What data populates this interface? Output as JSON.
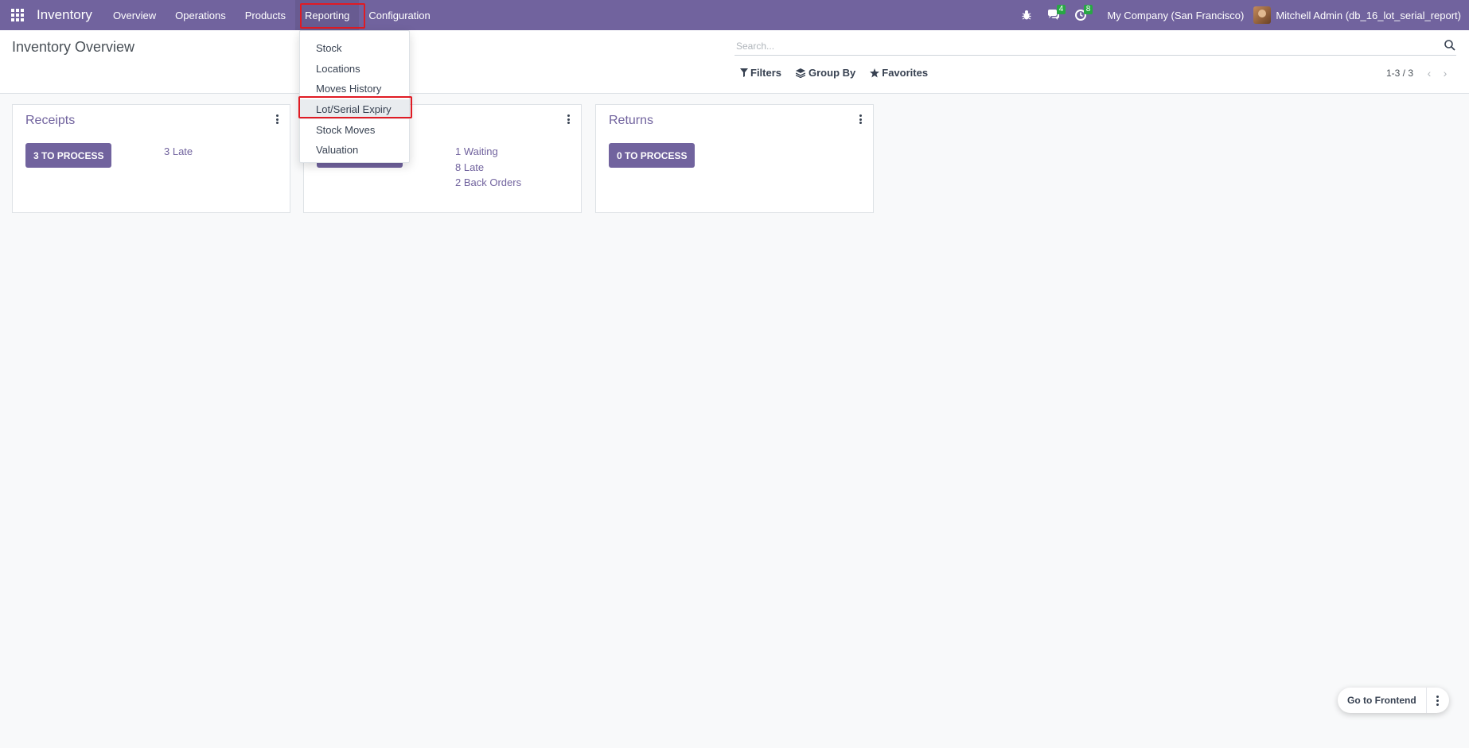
{
  "navbar": {
    "brand": "Inventory",
    "menu": [
      {
        "label": "Overview"
      },
      {
        "label": "Operations"
      },
      {
        "label": "Products"
      },
      {
        "label": "Reporting"
      },
      {
        "label": "Configuration"
      }
    ],
    "messages_badge": "4",
    "activities_badge": "8",
    "company": "My Company (San Francisco)",
    "user": "Mitchell Admin (db_16_lot_serial_report)"
  },
  "control_panel": {
    "title": "Inventory Overview",
    "search_placeholder": "Search...",
    "filters_label": "Filters",
    "group_by_label": "Group By",
    "favorites_label": "Favorites",
    "pager": "1-3 / 3"
  },
  "cards": [
    {
      "title": "Receipts",
      "button": "3 TO PROCESS",
      "stats": [
        "3 Late"
      ]
    },
    {
      "title": "",
      "button": "",
      "stats": [
        "1 Waiting",
        "8 Late",
        "2 Back Orders"
      ]
    },
    {
      "title": "Returns",
      "button": "0 TO PROCESS",
      "stats": []
    }
  ],
  "reporting_dropdown": {
    "items": [
      {
        "label": "Stock"
      },
      {
        "label": "Locations"
      },
      {
        "label": "Moves History"
      },
      {
        "label": "Lot/Serial Expiry"
      },
      {
        "label": "Stock Moves"
      },
      {
        "label": "Valuation"
      }
    ],
    "selected": "Lot/Serial Expiry"
  },
  "frontend": {
    "label": "Go to Frontend"
  },
  "colors": {
    "brand": "#71639e",
    "highlight": "#e01b24",
    "badge": "#28a745"
  }
}
